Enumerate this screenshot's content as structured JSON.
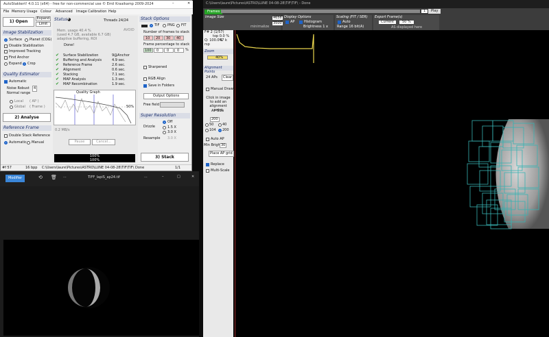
{
  "main_window": {
    "title": "AutoStakkert! 4.0.11 (x64) - free for non-commercial use © Emil Kraaikamp 2009-2024",
    "menu": [
      "File",
      "Memory Usage",
      "Colour",
      "Advanced",
      "Image Calibration",
      "Help"
    ],
    "open_button": "1) Open",
    "expand_button": "Expand",
    "limit_button": "Limit",
    "image_stabilization": {
      "header": "Image Stabilization",
      "surface": "Surface",
      "planet": "Planet (COG)",
      "disable": "Disable Stabilization",
      "improved": "Improved Tracking",
      "find_anchor": "Find Anchor",
      "expand": "Expand",
      "crop": "Crop"
    },
    "quality_estimator": {
      "header": "Quality Estimator",
      "automatic": "Automatic",
      "noise_robust": "Noise Robust",
      "noise_value": "4",
      "normal_range": "Normal range",
      "local": "Local",
      "local_ap": "( AP )",
      "global": "Global",
      "global_frame": "( Frame )"
    },
    "analyse_button": "2) Analyse",
    "reference_frame": {
      "header": "Reference Frame",
      "double_stack": "Double Stack Reference",
      "automatic": "Automatic",
      "manual": "Manual"
    },
    "status": {
      "header": "Status",
      "threads": "Threads 24/24",
      "avoid": "AVOID",
      "mem_usage": "Mem. usage 40.4 %",
      "mem_used": "(used 4.7 GB, available 6.7 GB)",
      "adaptive": "adaptive buffering, ROI",
      "done": "Done!",
      "steps": [
        {
          "label": "Surface Stabilization",
          "value": "9@Anchor"
        },
        {
          "label": "Buffering and Analysis",
          "value": "4.9 sec."
        },
        {
          "label": "Reference Frame",
          "value": "2.6 sec."
        },
        {
          "label": "Alignment",
          "value": "0.6 sec."
        },
        {
          "label": "Stacking",
          "value": "7.1 sec."
        },
        {
          "label": "MAP Analysis",
          "value": "1.3 sec."
        },
        {
          "label": "MAP Recombination",
          "value": "1.9 sec."
        }
      ],
      "quality_graph": "Quality Graph",
      "pct_50": "50%",
      "throughput": "0.2 MB/s",
      "pause": "Pause",
      "cancel": "Cancel...",
      "progress_1": "100%",
      "progress_2": "100%"
    },
    "stack_options": {
      "header": "Stack Options",
      "formats": [
        "TIF",
        "PNG",
        "FIT"
      ],
      "num_frames_label": "Number of frames to stack",
      "num_frames": [
        "10",
        "20",
        "30",
        "40"
      ],
      "frame_pct_label": "Frame percentage to stack",
      "frame_pct": [
        "100",
        "0",
        "0",
        "0"
      ],
      "pct_unit": "%",
      "sharpened": "Sharpened",
      "rgb_align": "RGB Align",
      "save_folders": "Save in Folders",
      "output_options": "Output Options",
      "free_field": "Free field"
    },
    "super_resolution": {
      "header": "Super Resolution",
      "drizzle": "Drizzle",
      "options": [
        "Off",
        "1.5 X",
        "3.0 X"
      ],
      "resample": "Resample",
      "resample_val": "3.0 X"
    },
    "stack_button": "3) Stack",
    "statusbar": {
      "frames": "#f 57",
      "bpp": "16 bpp",
      "path": "C:\\Users\\laure\\Pictures\\ASTRO\\LUNE 04-08-28\\TIF\\TIF\\",
      "state": "Done",
      "page": "1/1"
    }
  },
  "photo_window": {
    "modifier": "Modifier",
    "filename": "TIFF_lapiS_ap24.tif",
    "more": "...",
    "minimize": "–",
    "maximize": "□",
    "close": "✕"
  },
  "frame_window": {
    "title": "C:\\Users\\laure\\Pictures\\ASTRO\\LUNE 04-08-28\\TIF\\TIF\\ - Done",
    "frames_label": "Frames",
    "frame_num": "1",
    "play": "Play",
    "image_size": "Image Size",
    "size_w": "4656",
    "size_h": "3500",
    "view_min": "minimalize",
    "display_options": "Display Options",
    "ap": "AP",
    "histogram": "Histogram",
    "brightness": "Brightness 1 x",
    "scaling": "Scaling (FIT / SER)",
    "auto": "Auto",
    "range": "Range 16 bit(A)",
    "export": "Export Frame(s)",
    "current": "Current",
    "pct": "50 %",
    "as_displayed": "AS displayed here",
    "info_lines": [
      "F# 2 (1/57)",
      "Q: 100.0%",
      "top 0.0 %",
      "rsp",
      "47 k"
    ],
    "zoom": "Zoom",
    "zoom_val": "40%",
    "alignment_points": "Alignment Points",
    "ap_count": "24 APs",
    "clear": "Clear",
    "manual_draw": "Manual Draw",
    "click_hint": "Click in image to add an alignment point",
    "ap_size": "AP Size",
    "ap_size_val": "200",
    "ap_sizes": [
      "50",
      "40",
      "104",
      "200"
    ],
    "auto_ap": "Auto AP",
    "min_bright": "Min Bright",
    "min_bright_val": "30",
    "place_grid": "Place AP grid",
    "replace": "Replace",
    "multi_scale": "Multi-Scale"
  },
  "colors": {
    "accent": "#1f64c8",
    "green": "#2e9b2e",
    "ap_box": "#38b2b2",
    "graph": "#e8d44d"
  }
}
